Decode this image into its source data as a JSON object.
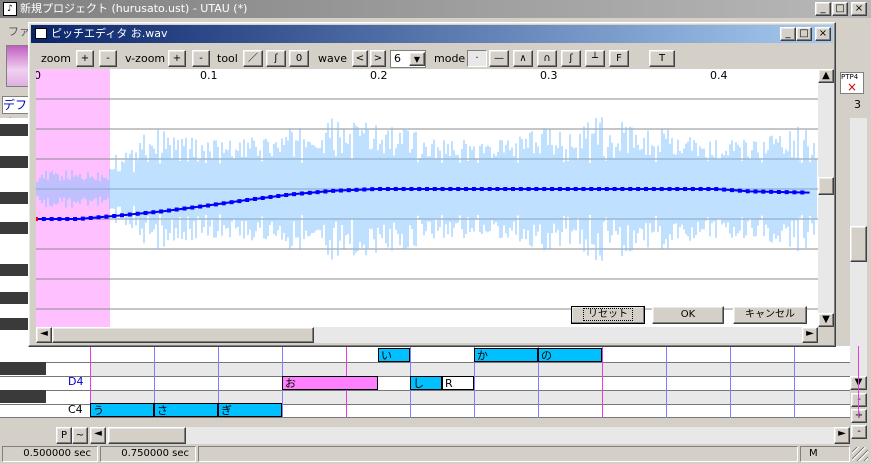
{
  "main_window": {
    "title": "新規プロジェクト (hurusato.ust) - UTAU (*)",
    "menu_first": "ファイ",
    "left_tab": "デフォ",
    "right_number": "3",
    "ptp_label": "PTP4"
  },
  "pitch_window": {
    "title": "ピッチエディタ お.wav",
    "toolbar": {
      "zoom_label": "zoom",
      "vzoom_label": "v-zoom",
      "tool_label": "tool",
      "wave_label": "wave",
      "mode_label": "mode",
      "plus": "+",
      "minus": "-",
      "tool_line": "／",
      "tool_curve": "ʃ",
      "tool_zero": "0",
      "wave_prev": "<",
      "wave_next": ">",
      "wave_value": "6",
      "mode_dot": "·",
      "mode_flat": "—",
      "mode_peak": "∧",
      "mode_arch": "∩",
      "mode_s": "ʃ",
      "mode_step": "┴",
      "mode_f": "F",
      "mode_t": "T"
    },
    "ruler": [
      "0",
      "0.1",
      "0.2",
      "0.3",
      "0.4"
    ],
    "reset_button": "リセット",
    "ok_button": "OK",
    "cancel_button": "キャンセル"
  },
  "piano_roll": {
    "key_labels": [
      "D4",
      "C4"
    ],
    "notes": [
      {
        "lyric": "い",
        "row": 0,
        "start": 4.5,
        "len": 0.5,
        "kind": "normal"
      },
      {
        "lyric": "か",
        "row": 0,
        "start": 6,
        "len": 1,
        "kind": "normal"
      },
      {
        "lyric": "の",
        "row": 0,
        "start": 7,
        "len": 1,
        "kind": "normal"
      },
      {
        "lyric": "お",
        "row": 1,
        "start": 3,
        "len": 1.5,
        "kind": "selected"
      },
      {
        "lyric": "し",
        "row": 1,
        "start": 5,
        "len": 0.5,
        "kind": "normal"
      },
      {
        "lyric": "R",
        "row": 1,
        "start": 5.5,
        "len": 0.5,
        "kind": "rest"
      },
      {
        "lyric": "う",
        "row": 2,
        "start": 0,
        "len": 1,
        "kind": "normal"
      },
      {
        "lyric": "さ",
        "row": 2,
        "start": 1,
        "len": 1,
        "kind": "normal"
      },
      {
        "lyric": "ぎ",
        "row": 2,
        "start": 2,
        "len": 1,
        "kind": "normal"
      }
    ],
    "p_button": "P",
    "tilde_button": "~"
  },
  "status_bar": {
    "time1": "0.500000 sec",
    "time2": "0.750000 sec",
    "mode": "M"
  },
  "colors": {
    "note": "#00c0ff",
    "note_selected": "#ff80ff",
    "waveform": "#80c0ff",
    "pitch_line": "#0000ff",
    "pitch_start": "#ff0000",
    "highlight": "#ffc0ff"
  },
  "pitch_curve": [
    {
      "t": 0.0,
      "v": -0.5
    },
    {
      "t": 0.025,
      "v": -0.5
    },
    {
      "t": 0.05,
      "v": -0.44
    },
    {
      "t": 0.075,
      "v": -0.37
    },
    {
      "t": 0.1,
      "v": -0.28
    },
    {
      "t": 0.125,
      "v": -0.18
    },
    {
      "t": 0.15,
      "v": -0.09
    },
    {
      "t": 0.175,
      "v": -0.03
    },
    {
      "t": 0.2,
      "v": 0.0
    },
    {
      "t": 0.3,
      "v": 0.0
    },
    {
      "t": 0.4,
      "v": 0.0
    },
    {
      "t": 0.42,
      "v": -0.04
    },
    {
      "t": 0.455,
      "v": -0.06
    }
  ]
}
